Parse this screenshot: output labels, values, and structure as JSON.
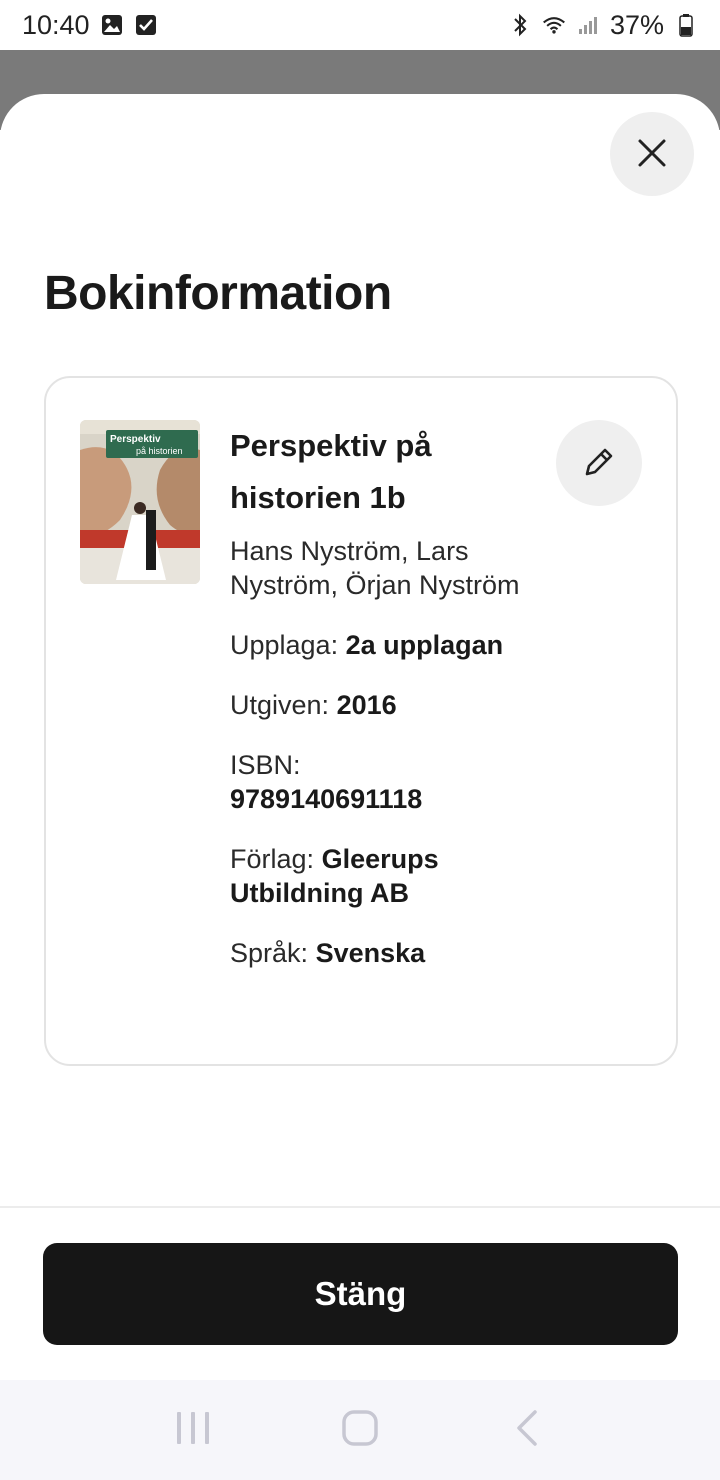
{
  "status_bar": {
    "time": "10:40",
    "battery": "37%",
    "icons": [
      "gallery-icon",
      "checkbox-icon",
      "bluetooth-icon",
      "wifi-icon",
      "signal-icon",
      "battery-icon"
    ]
  },
  "sheet": {
    "title": "Bokinformation",
    "close_icon": "close-icon"
  },
  "book": {
    "cover_alt": "Perspektiv på historien",
    "title": "Perspektiv på historien 1b",
    "authors": "Hans Nyström, Lars Nyström, Örjan Nyström",
    "fields": {
      "edition_label": "Upplaga:",
      "edition_value": "2a upplagan",
      "published_label": "Utgiven:",
      "published_value": "2016",
      "isbn_label": "ISBN:",
      "isbn_value": "9789140691118",
      "publisher_label": "Förlag:",
      "publisher_value": "Gleerups Utbildning AB",
      "language_label": "Språk:",
      "language_value": "Svenska"
    },
    "edit_icon": "pencil-icon"
  },
  "footer": {
    "close_label": "Stäng"
  },
  "nav_bar": {
    "icons": [
      "recent-apps-icon",
      "home-icon",
      "back-icon"
    ]
  }
}
